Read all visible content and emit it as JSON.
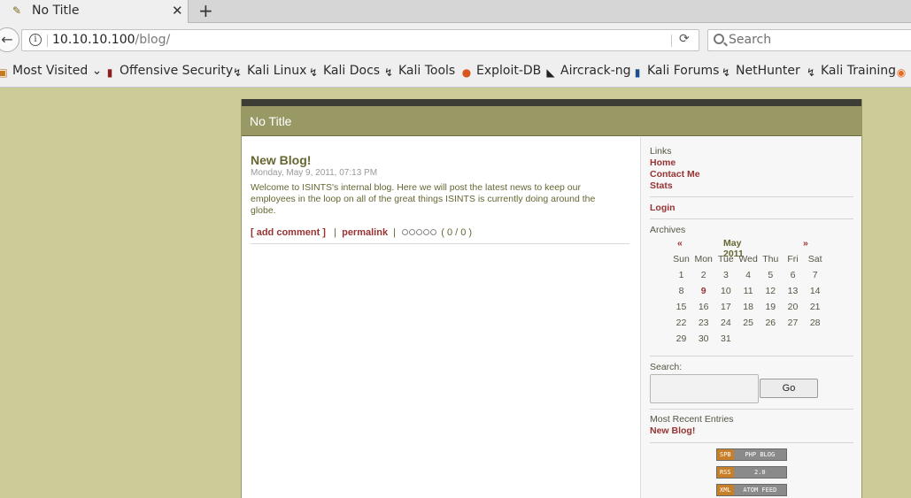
{
  "browser": {
    "tab_title": "No Title",
    "url_host": "10.10.10.100",
    "url_path": "/blog/",
    "search_placeholder": "Search",
    "bookmarks": [
      "Most Visited",
      "Offensive Security",
      "Kali Linux",
      "Kali Docs",
      "Kali Tools",
      "Exploit-DB",
      "Aircrack-ng",
      "Kali Forums",
      "NetHunter",
      "Kali Training"
    ]
  },
  "site": {
    "title": "No Title"
  },
  "post": {
    "title": "New Blog!",
    "date": "Monday, May 9, 2011, 07:13 PM",
    "body": "Welcome to ISINTS's internal blog. Here we will post the latest news to keep our employees in the loop on all of the great things ISINTS is currently doing around the globe.",
    "add_comment": "[ add comment ]",
    "permalink": "permalink",
    "rating": "( 0 / 0 )"
  },
  "sidebar": {
    "links_label": "Links",
    "links": [
      "Home",
      "Contact Me",
      "Stats"
    ],
    "login": "Login",
    "archives_label": "Archives",
    "calendar": {
      "prev": "«",
      "next": "»",
      "month": "May 2011",
      "weekdays": [
        "Sun",
        "Mon",
        "Tue",
        "Wed",
        "Thu",
        "Fri",
        "Sat"
      ],
      "weeks": [
        [
          "1",
          "2",
          "3",
          "4",
          "5",
          "6",
          "7"
        ],
        [
          "8",
          "9",
          "10",
          "11",
          "12",
          "13",
          "14"
        ],
        [
          "15",
          "16",
          "17",
          "18",
          "19",
          "20",
          "21"
        ],
        [
          "22",
          "23",
          "24",
          "25",
          "26",
          "27",
          "28"
        ],
        [
          "29",
          "30",
          "31",
          "",
          "",
          "",
          ""
        ]
      ],
      "highlight_day": "9"
    },
    "search_label": "Search:",
    "search_button": "Go",
    "recent_label": "Most Recent Entries",
    "recent_entries": [
      "New Blog!"
    ],
    "badges": [
      {
        "left": "SPB",
        "right": "PHP BLOG"
      },
      {
        "left": "RSS",
        "right": "2.0"
      },
      {
        "left": "XML",
        "right": "ATOM FEED"
      }
    ]
  }
}
